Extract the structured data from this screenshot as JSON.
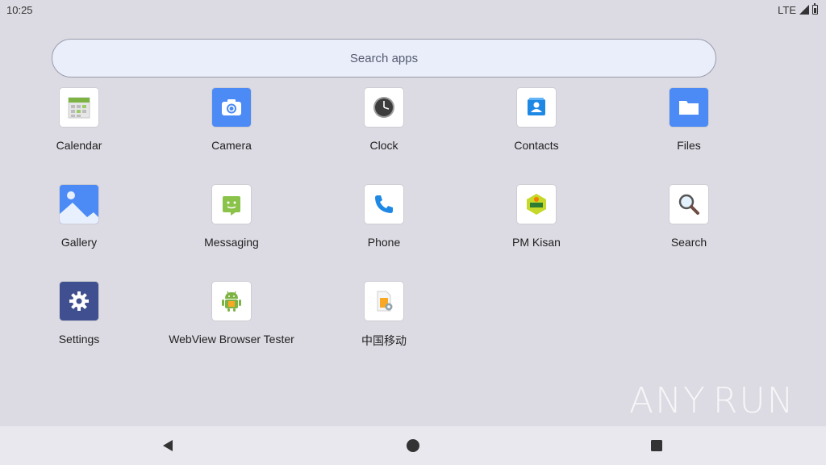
{
  "status_bar": {
    "time": "10:25",
    "network": "LTE"
  },
  "search": {
    "placeholder": "Search apps"
  },
  "apps": [
    {
      "label": "Calendar",
      "icon": "calendar-icon"
    },
    {
      "label": "Camera",
      "icon": "camera-icon"
    },
    {
      "label": "Clock",
      "icon": "clock-icon"
    },
    {
      "label": "Contacts",
      "icon": "contacts-icon"
    },
    {
      "label": "Files",
      "icon": "files-icon"
    },
    {
      "label": "Gallery",
      "icon": "gallery-icon"
    },
    {
      "label": "Messaging",
      "icon": "messaging-icon"
    },
    {
      "label": "Phone",
      "icon": "phone-icon"
    },
    {
      "label": "PM Kisan",
      "icon": "pm-kisan-icon"
    },
    {
      "label": "Search",
      "icon": "search-icon"
    },
    {
      "label": "Settings",
      "icon": "settings-icon"
    },
    {
      "label": "WebView Browser Tester",
      "icon": "android-icon"
    },
    {
      "label": "中国移动",
      "icon": "sim-toolkit-icon"
    }
  ],
  "navigation": {
    "back": "back-icon",
    "home": "home-icon",
    "recents": "recents-icon"
  },
  "watermark": {
    "text_left": "ANY",
    "text_right": "RUN"
  },
  "colors": {
    "background": "#dcdae2",
    "camera_blue": "#4c8bf5",
    "files_blue": "#4c8bf5",
    "settings_navy": "#3f4f8f",
    "phone_blue": "#1e88e5"
  }
}
